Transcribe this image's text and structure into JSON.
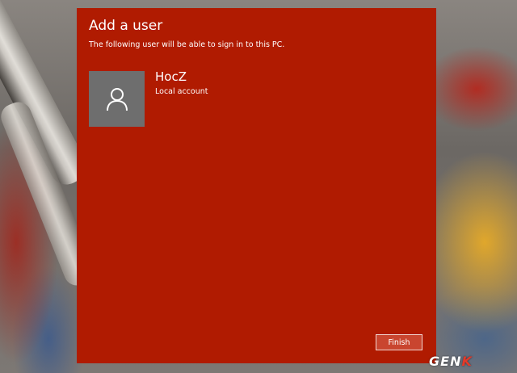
{
  "dialog": {
    "title": "Add a user",
    "subtitle": "The following user will be able to sign in to this PC.",
    "background_color": "#b01b01"
  },
  "user": {
    "avatar_icon": "user-silhouette-icon",
    "name": "HocZ",
    "account_type": "Local account"
  },
  "buttons": {
    "finish_label": "Finish"
  },
  "watermark": {
    "text": "GENK"
  }
}
